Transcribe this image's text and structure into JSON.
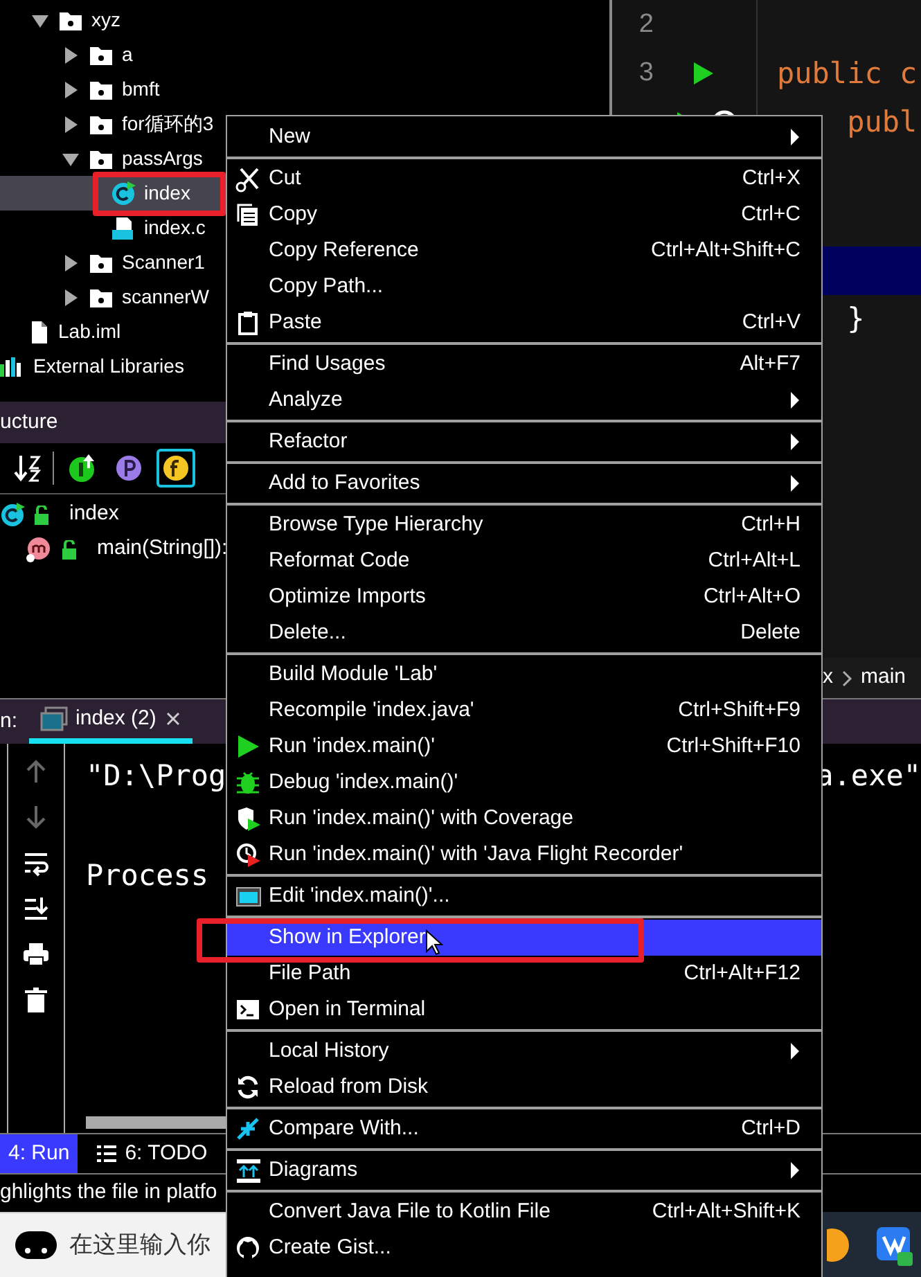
{
  "project_tree": [
    {
      "label": "xyz",
      "kind": "package",
      "expanded": true,
      "selected": false,
      "children": [
        {
          "label": "a",
          "kind": "package",
          "expanded": false,
          "selected": false
        },
        {
          "label": "bmft",
          "kind": "package",
          "expanded": false,
          "selected": false
        },
        {
          "label": "for循环的3",
          "kind": "package",
          "expanded": false,
          "selected": false
        },
        {
          "label": "passArgs",
          "kind": "package",
          "expanded": true,
          "selected": false,
          "children": [
            {
              "label": "index",
              "kind": "class",
              "selected": true
            },
            {
              "label": "index.c",
              "kind": "classfile",
              "selected": false
            }
          ]
        },
        {
          "label": "Scanner1",
          "kind": "package",
          "expanded": false,
          "selected": false
        },
        {
          "label": "scannerW",
          "kind": "package",
          "expanded": false,
          "selected": false
        }
      ]
    },
    {
      "label": "Lab.iml",
      "kind": "module-file",
      "selected": false
    },
    {
      "label": "External Libraries",
      "kind": "library",
      "selected": false
    }
  ],
  "structure_panel": {
    "title": "ucture",
    "filters": [
      {
        "kind": "inherited",
        "on": false
      },
      {
        "kind": "properties",
        "on": false
      },
      {
        "kind": "fields",
        "on": true
      }
    ],
    "items": [
      {
        "label": "index",
        "kind": "class",
        "children": [
          {
            "label": "main(String[]):",
            "kind": "method"
          }
        ]
      }
    ]
  },
  "editor": {
    "lines": [
      {
        "number": "2",
        "highlighted": false
      },
      {
        "number": "3",
        "code": "public c",
        "kind": "keyword",
        "highlighted": false
      },
      {
        "code": "    publ",
        "kind": "keyword",
        "highlighted": false
      },
      {
        "highlighted": false
      },
      {
        "highlighted": false
      },
      {
        "highlighted": true
      },
      {
        "code": "    }",
        "kind": "plain",
        "highlighted": false
      }
    ],
    "breadcrumbs": [
      "x",
      "main"
    ]
  },
  "run_panel": {
    "label": "n:",
    "tabs": [
      {
        "label": "index (2)",
        "selected": true
      }
    ],
    "console_lines": [
      {
        "segments": [
          "\"D:\\Prog",
          "a.exe\""
        ]
      },
      {
        "segments": [
          "Process"
        ]
      }
    ]
  },
  "tool_window_bar": [
    {
      "label": "4: Run",
      "kind": "run",
      "selected": true
    },
    {
      "label": "6: TODO",
      "kind": "todo",
      "selected": false
    }
  ],
  "status_bar": "ghlights the file in platfo",
  "taskbar": {
    "search_placeholder": "在这里输入你"
  },
  "context_menu": [
    {
      "kind": "item",
      "label": "New",
      "submenu": true
    },
    {
      "kind": "separator"
    },
    {
      "kind": "item",
      "label": "Cut",
      "shortcut": "Ctrl+X"
    },
    {
      "kind": "item",
      "label": "Copy",
      "shortcut": "Ctrl+C"
    },
    {
      "kind": "item",
      "label": "Copy Reference",
      "shortcut": "Ctrl+Alt+Shift+C"
    },
    {
      "kind": "item",
      "label": "Copy Path..."
    },
    {
      "kind": "item",
      "label": "Paste",
      "shortcut": "Ctrl+V"
    },
    {
      "kind": "separator"
    },
    {
      "kind": "item",
      "label": "Find Usages",
      "shortcut": "Alt+F7"
    },
    {
      "kind": "item",
      "label": "Analyze",
      "submenu": true
    },
    {
      "kind": "separator"
    },
    {
      "kind": "item",
      "label": "Refactor",
      "submenu": true
    },
    {
      "kind": "separator"
    },
    {
      "kind": "item",
      "label": "Add to Favorites",
      "submenu": true
    },
    {
      "kind": "separator"
    },
    {
      "kind": "item",
      "label": "Browse Type Hierarchy",
      "shortcut": "Ctrl+H"
    },
    {
      "kind": "item",
      "label": "Reformat Code",
      "shortcut": "Ctrl+Alt+L"
    },
    {
      "kind": "item",
      "label": "Optimize Imports",
      "shortcut": "Ctrl+Alt+O"
    },
    {
      "kind": "item",
      "label": "Delete...",
      "shortcut": "Delete"
    },
    {
      "kind": "separator"
    },
    {
      "kind": "item",
      "label": "Build Module 'Lab'"
    },
    {
      "kind": "item",
      "label": "Recompile 'index.java'",
      "shortcut": "Ctrl+Shift+F9"
    },
    {
      "kind": "item",
      "label": "Run 'index.main()'",
      "shortcut": "Ctrl+Shift+F10"
    },
    {
      "kind": "item",
      "label": "Debug 'index.main()'"
    },
    {
      "kind": "item",
      "label": "Run 'index.main()' with Coverage"
    },
    {
      "kind": "item",
      "label": "Run 'index.main()' with 'Java Flight Recorder'"
    },
    {
      "kind": "separator"
    },
    {
      "kind": "item",
      "label": "Edit 'index.main()'..."
    },
    {
      "kind": "separator"
    },
    {
      "kind": "item",
      "label": "Show in Explorer",
      "selected": true
    },
    {
      "kind": "item",
      "label": "File Path",
      "shortcut": "Ctrl+Alt+F12"
    },
    {
      "kind": "item",
      "label": "Open in Terminal"
    },
    {
      "kind": "separator"
    },
    {
      "kind": "item",
      "label": "Local History",
      "submenu": true
    },
    {
      "kind": "item",
      "label": "Reload from Disk"
    },
    {
      "kind": "separator"
    },
    {
      "kind": "item",
      "label": "Compare With...",
      "shortcut": "Ctrl+D"
    },
    {
      "kind": "separator"
    },
    {
      "kind": "item",
      "label": "Diagrams",
      "submenu": true
    },
    {
      "kind": "separator"
    },
    {
      "kind": "item",
      "label": "Convert Java File to Kotlin File",
      "shortcut": "Ctrl+Alt+Shift+K"
    },
    {
      "kind": "item",
      "label": "Create Gist..."
    }
  ]
}
